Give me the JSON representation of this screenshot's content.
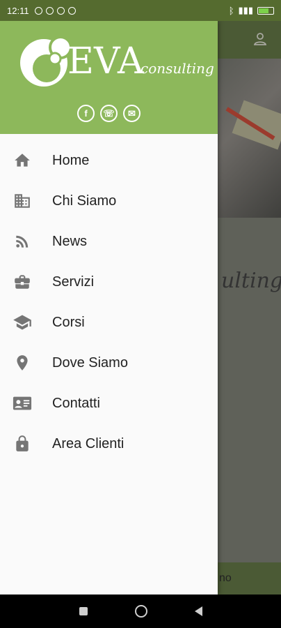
{
  "status_bar": {
    "time": "12:11",
    "battery_icon": "battery-icon"
  },
  "drawer": {
    "logo": {
      "main": "EVA",
      "sub": "consulting"
    },
    "social": [
      {
        "name": "facebook-icon",
        "glyph": "f"
      },
      {
        "name": "phone-icon",
        "glyph": "☏"
      },
      {
        "name": "mail-icon",
        "glyph": "✉"
      }
    ],
    "menu": [
      {
        "label": "Home",
        "icon": "home-icon"
      },
      {
        "label": "Chi Siamo",
        "icon": "building-icon"
      },
      {
        "label": "News",
        "icon": "rss-icon"
      },
      {
        "label": "Servizi",
        "icon": "briefcase-icon"
      },
      {
        "label": "Corsi",
        "icon": "graduation-cap-icon"
      },
      {
        "label": "Dove Siamo",
        "icon": "location-pin-icon"
      },
      {
        "label": "Contatti",
        "icon": "contact-card-icon"
      },
      {
        "label": "Area Clienti",
        "icon": "lock-icon"
      }
    ]
  },
  "background": {
    "script_text": "ulting",
    "footer_text": "no"
  },
  "colors": {
    "drawer_header": "#8db85b",
    "status_bar": "#556b2f",
    "menu_icon": "#757575"
  }
}
